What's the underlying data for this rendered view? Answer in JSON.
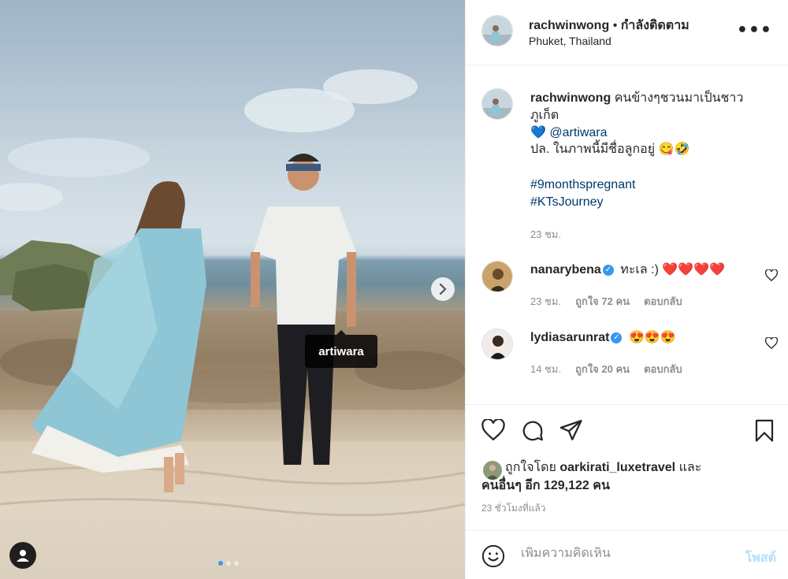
{
  "post": {
    "author": "rachwinwong",
    "follow_status": "กำลังติดตาม",
    "location": "Phuket, Thailand",
    "photo_tag": "artiwara",
    "carousel_count": 3,
    "carousel_active": 1
  },
  "caption": {
    "username": "rachwinwong",
    "text": "คนข้างๆชวนมาเป็นชาวภูเก็ต",
    "mention": "@artiwara",
    "note": "ปล. ในภาพนี้มีชื่อลูกอยู่",
    "hashtags": [
      "#9monthspregnant",
      "#KTsJourney"
    ],
    "time": "23 ชม."
  },
  "comments": [
    {
      "username": "nanarybena",
      "verified": true,
      "text": "ทะเล :)",
      "time": "23 ชม.",
      "likes": "ถูกใจ 72 คน",
      "reply": "ตอบกลับ"
    },
    {
      "username": "lydiasarunrat",
      "verified": true,
      "text": "",
      "time": "14 ชม.",
      "likes": "ถูกใจ 20 คน",
      "reply": "ตอบกลับ"
    }
  ],
  "likes": {
    "prefix": "ถูกใจโดย",
    "user": "oarkirati_luxetravel",
    "and": "และ",
    "others": "คนอื่นๆ อีก 129,122 คน"
  },
  "posted_time": "23 ชั่วโมงที่แล้ว",
  "add_comment": {
    "placeholder": "เพิ่มความคิดเห็น",
    "post_label": "โพสต์"
  },
  "icons": {
    "heart": "heart-icon",
    "comment": "comment-icon",
    "share": "share-icon",
    "save": "bookmark-icon",
    "emoji": "emoji-icon",
    "more": "more-icon",
    "next": "chevron-right-icon",
    "user_tags": "user-icon"
  },
  "colors": {
    "link": "#00376b",
    "muted": "#8e8e8e",
    "accent": "#3897f0",
    "post_disabled": "#b2dffc"
  }
}
